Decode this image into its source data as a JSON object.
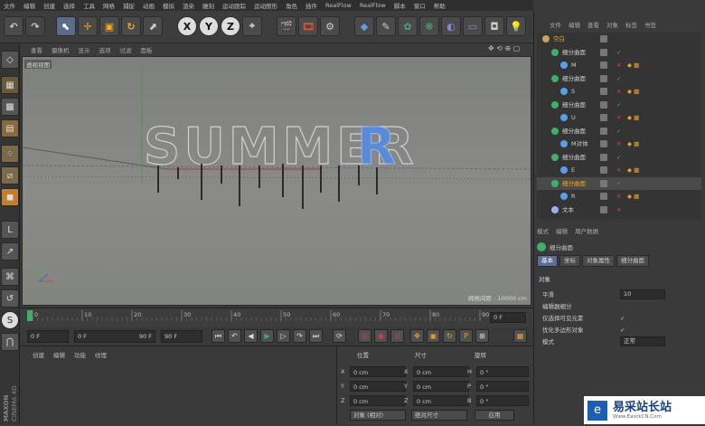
{
  "menu": [
    "文件",
    "编辑",
    "创建",
    "选择",
    "工具",
    "网格",
    "捕捉",
    "动画",
    "模拟",
    "渲染",
    "雕刻",
    "运动跟踪",
    "运动图形",
    "角色",
    "插件",
    "RealFlow",
    "RealFlow",
    "脚本",
    "窗口",
    "帮助"
  ],
  "toolbar": {
    "undo_icon": "undo-icon",
    "axis_x": "X",
    "axis_y": "Y",
    "axis_z": "Z"
  },
  "viewport": {
    "menu": [
      "查看",
      "摄像机",
      "显示",
      "选项",
      "过滤",
      "面板"
    ],
    "label": "透视视图",
    "headline": "SUMMER",
    "grid_spacing": "网格间距 : 10000 cm"
  },
  "timeline": {
    "ticks": [
      "0",
      "10",
      "20",
      "30",
      "40",
      "50",
      "60",
      "70",
      "80",
      "90"
    ],
    "current_frame": "0 F"
  },
  "transport": {
    "start": "0 F",
    "min": "0 F",
    "max": "90 F",
    "end": "90 F"
  },
  "material": {
    "menu": [
      "创建",
      "编辑",
      "功能",
      "纹理"
    ]
  },
  "coords": {
    "headers": [
      "位置",
      "尺寸",
      "旋转"
    ],
    "rows": [
      {
        "axis": "X",
        "pos": "0 cm",
        "size_axis": "X",
        "size": "0 cm",
        "rot_axis": "H",
        "rot": "0 °"
      },
      {
        "axis": "Y",
        "pos": "0 cm",
        "size_axis": "Y",
        "size": "0 cm",
        "rot_axis": "P",
        "rot": "0 °"
      },
      {
        "axis": "Z",
        "pos": "0 cm",
        "size_axis": "Z",
        "size": "0 cm",
        "rot_axis": "B",
        "rot": "0 °"
      }
    ],
    "mode": "对象 (相对)",
    "size_mode": "绝对尺寸",
    "apply": "应用"
  },
  "object_manager": {
    "tabs": [
      "文件",
      "编辑",
      "查看",
      "对象",
      "标签",
      "书签"
    ],
    "objects": [
      {
        "name": "空白",
        "indent": 0,
        "type": "null"
      },
      {
        "name": "细分曲面",
        "indent": 1,
        "type": "subd"
      },
      {
        "name": "M",
        "indent": 2,
        "type": "poly"
      },
      {
        "name": "细分曲面",
        "indent": 1,
        "type": "subd"
      },
      {
        "name": "S",
        "indent": 2,
        "type": "poly"
      },
      {
        "name": "细分曲面",
        "indent": 1,
        "type": "subd"
      },
      {
        "name": "U",
        "indent": 2,
        "type": "poly"
      },
      {
        "name": "细分曲面",
        "indent": 1,
        "type": "subd"
      },
      {
        "name": "M对体",
        "indent": 2,
        "type": "poly"
      },
      {
        "name": "细分曲面",
        "indent": 1,
        "type": "subd"
      },
      {
        "name": "E",
        "indent": 2,
        "type": "poly"
      },
      {
        "name": "细分曲面",
        "indent": 1,
        "type": "subd",
        "selected": true
      },
      {
        "name": "R",
        "indent": 2,
        "type": "poly"
      },
      {
        "name": "文本",
        "indent": 1,
        "type": "text"
      }
    ]
  },
  "attributes": {
    "menu": [
      "模式",
      "编辑",
      "用户数据"
    ],
    "object_title": "细分曲面",
    "tabs": [
      "基本",
      "坐标",
      "对象属性",
      "细分曲面"
    ],
    "section": "对象",
    "fields": [
      {
        "label": "平滑",
        "value": "10"
      },
      {
        "label": "编辑器细分",
        "value": ""
      },
      {
        "label": "仅选择可见元素",
        "value": "✓"
      },
      {
        "label": "优化多边形对象",
        "value": "✓"
      },
      {
        "label": "模式",
        "value": "正常"
      }
    ]
  },
  "brand": {
    "vertical": "MAXON CINEMA 4D"
  },
  "watermark": {
    "title": "易采站长站",
    "url": "Www.EasckCN.Com"
  },
  "colors": {
    "accent": "#5b6f96",
    "viewport": "#82847f",
    "bg": "#3a3a3a",
    "highlight_r": "#5a8ad8"
  }
}
